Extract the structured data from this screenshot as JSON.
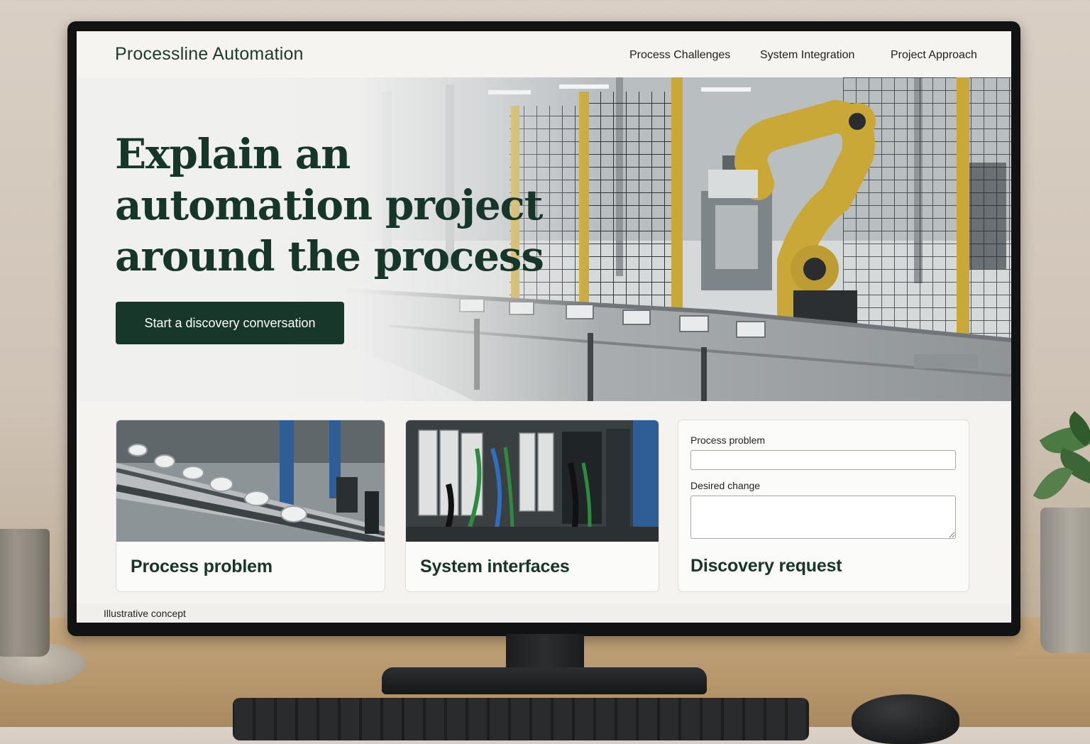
{
  "nav": {
    "brand": "Processline Automation",
    "links": [
      "Process Challenges",
      "System Integration",
      "Project Approach"
    ]
  },
  "hero": {
    "title": "Explain an automation project around the process",
    "cta_label": "Start a discovery conversation"
  },
  "cards": [
    {
      "title": "Process problem"
    },
    {
      "title": "System interfaces"
    },
    {
      "title": "Discovery request",
      "fields": [
        {
          "label": "Process problem",
          "value": ""
        },
        {
          "label": "Desired change",
          "value": ""
        }
      ]
    }
  ],
  "footnote": "Illustrative concept",
  "colors": {
    "brand_green": "#17362a",
    "cta_background": "#16372a",
    "robot_yellow": "#c9a838"
  }
}
